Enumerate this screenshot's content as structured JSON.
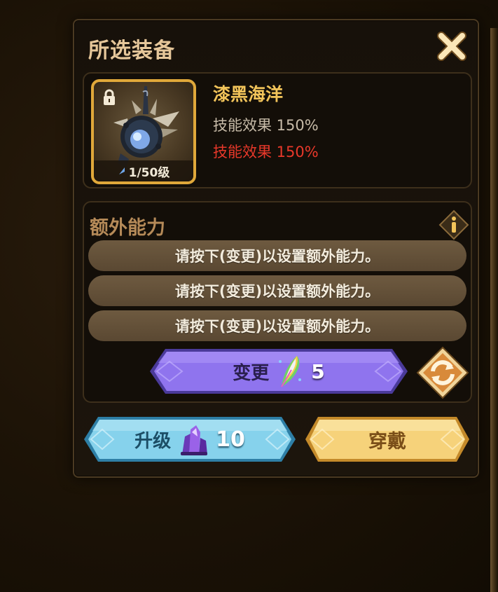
{
  "panel": {
    "title": "所选装备",
    "close_icon": "close-x-icon"
  },
  "item": {
    "name": "漆黑海洋",
    "stat_current": "技能效果 150%",
    "stat_next": "技能效果 150%",
    "level": "1/50级",
    "locked": true,
    "icon": "dark-ocean-weapon-icon"
  },
  "extra_ability": {
    "title": "额外能力",
    "info_icon": "info-icon",
    "slots": [
      "请按下(变更)以设置额外能力。",
      "请按下(变更)以设置额外能力。",
      "请按下(变更)以设置额外能力。"
    ],
    "change_button": {
      "label": "变更",
      "cost": "5",
      "cost_icon": "rainbow-feather-icon"
    },
    "refresh_icon": "refresh-icon"
  },
  "actions": {
    "upgrade": {
      "label": "升级",
      "cost": "10",
      "cost_icon": "purple-crystal-icon"
    },
    "equip": {
      "label": "穿戴"
    }
  },
  "colors": {
    "title": "#e6c79a",
    "item_name": "#f2c45a",
    "stat_next": "#e8382a",
    "frame_gold": "#e0a83a",
    "change_button": "#8a6ae8",
    "upgrade_button": "#7ecbe8",
    "equip_button": "#f4cc6a"
  }
}
